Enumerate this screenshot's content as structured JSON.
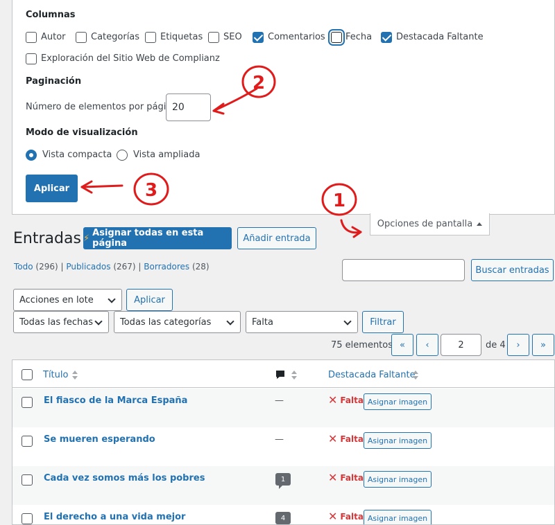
{
  "screen_options": {
    "columns_legend": "Columnas",
    "columns": [
      {
        "label": "Autor",
        "checked": false
      },
      {
        "label": "Categorías",
        "checked": false
      },
      {
        "label": "Etiquetas",
        "checked": false
      },
      {
        "label": "SEO",
        "checked": false
      },
      {
        "label": "Comentarios",
        "checked": true
      },
      {
        "label": "Fecha",
        "checked": false
      },
      {
        "label": "Destacada Faltante",
        "checked": true
      },
      {
        "label": "Exploración del Sitio Web de Complianz",
        "checked": false
      }
    ],
    "pagination_legend": "Paginación",
    "per_page_label": "Número de elementos por página:",
    "per_page_value": "20",
    "view_mode_legend": "Modo de visualización",
    "view_compact": "Vista compacta",
    "view_extended": "Vista ampliada",
    "apply": "Aplicar",
    "tab_label": "Opciones de pantalla"
  },
  "header": {
    "title": "Entradas",
    "assign_all": "Asignar todas en esta página",
    "add_new": "Añadir entrada"
  },
  "subsubsub": {
    "all": "Todo",
    "all_count": "(296)",
    "published": "Publicados",
    "published_count": "(267)",
    "drafts": "Borradores",
    "drafts_count": "(28)"
  },
  "search": {
    "value": "",
    "button": "Buscar entradas"
  },
  "bulk": {
    "select": "Acciones en lote",
    "apply": "Aplicar"
  },
  "filters": {
    "dates": "Todas las fechas",
    "categories": "Todas las categorías",
    "missing": "Falta",
    "button": "Filtrar"
  },
  "pagination": {
    "items": "75 elementos",
    "first": "«",
    "prev": "‹",
    "current": "2",
    "of": "de 4",
    "next": "›",
    "last": "»"
  },
  "table": {
    "col_title": "Título",
    "col_featured": "Destacada Faltante",
    "rows": [
      {
        "title": "El fiasco de la Marca España",
        "comments": "—",
        "status": "Falta",
        "action": "Asignar imagen"
      },
      {
        "title": "Se mueren esperando",
        "comments": "—",
        "status": "Falta",
        "action": "Asignar imagen"
      },
      {
        "title": "Cada vez somos más los pobres",
        "comments": "1",
        "status": "Falta",
        "action": "Asignar imagen"
      },
      {
        "title": "El derecho a una vida mejor",
        "comments": "4",
        "status": "Falta",
        "action": "Asignar imagen"
      }
    ]
  },
  "annotations": {
    "one": "1",
    "two": "2",
    "three": "3"
  }
}
